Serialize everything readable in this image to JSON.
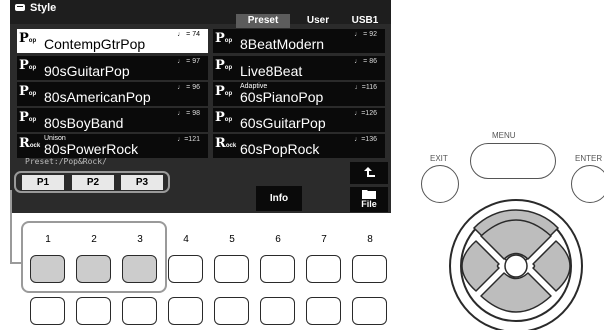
{
  "screen": {
    "title": "Style",
    "tabs": [
      "Preset",
      "User",
      "USB1"
    ],
    "active_tab": "Preset",
    "styles": [
      {
        "genre": "Pop",
        "name": "ContempGtrPop",
        "tempo": "♩ = 74",
        "sub": "",
        "selected": true
      },
      {
        "genre": "Pop",
        "name": "8BeatModern",
        "tempo": "♩ = 92",
        "sub": "",
        "selected": false
      },
      {
        "genre": "Pop",
        "name": "90sGuitarPop",
        "tempo": "♩ = 97",
        "sub": "",
        "selected": false
      },
      {
        "genre": "Pop",
        "name": "Live8Beat",
        "tempo": "♩ = 86",
        "sub": "",
        "selected": false
      },
      {
        "genre": "Pop",
        "name": "80sAmericanPop",
        "tempo": "♩ = 96",
        "sub": "",
        "selected": false
      },
      {
        "genre": "Pop",
        "name": "60sPianoPop",
        "tempo": "♩=116",
        "sub": "Adaptive",
        "selected": false
      },
      {
        "genre": "Pop",
        "name": "80sBoyBand",
        "tempo": "♩ = 98",
        "sub": "",
        "selected": false
      },
      {
        "genre": "Pop",
        "name": "60sGuitarPop",
        "tempo": "♩=126",
        "sub": "",
        "selected": false
      },
      {
        "genre": "Rock",
        "name": "80sPowerRock",
        "tempo": "♩=121",
        "sub": "Unison",
        "selected": false
      },
      {
        "genre": "Rock",
        "name": "60sPopRock",
        "tempo": "♩=136",
        "sub": "",
        "selected": false
      }
    ],
    "path": "Preset:/Pop&Rock/",
    "page_buttons": [
      "P1",
      "P2",
      "P3"
    ],
    "info_label": "Info",
    "file_label": "File"
  },
  "panel": {
    "button_numbers": [
      "1",
      "2",
      "3",
      "4",
      "5",
      "6",
      "7",
      "8"
    ],
    "menu_label": "MENU",
    "exit_label": "EXIT",
    "enter_label": "ENTER"
  }
}
